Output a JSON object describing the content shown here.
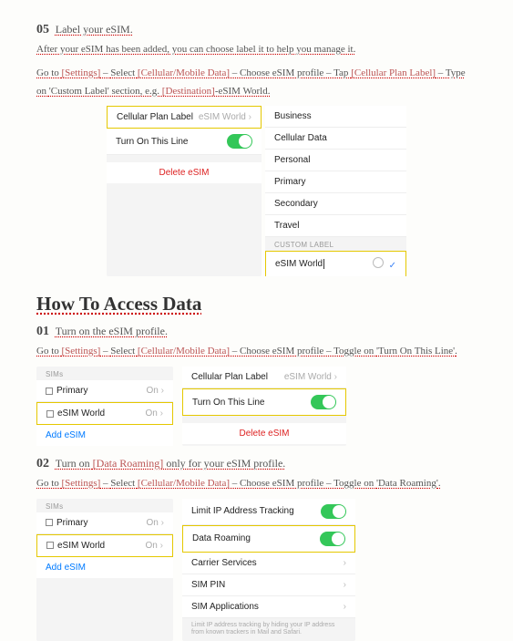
{
  "step05": {
    "num": "05",
    "title": "Label your eSIM.",
    "line1": "After your eSIM has been added, you can choose label it to help you manage it.",
    "line2a": "Go to ",
    "settings": "[Settings]",
    "sep": " – ",
    "select": "Select ",
    "cellular": "[Cellular/Mobile Data]",
    "choose": " – Choose eSIM profile – Tap ",
    "planlabel": "[Cellular Plan Label]",
    "typeon": " – Type on ",
    "customlabel": "'Custom Label'",
    "sectiontxt": " section, e.g. ",
    "dest": "[Destination]",
    "esimworld": "-eSIM World."
  },
  "mock05": {
    "cellularPlanLabel": "Cellular Plan Label",
    "esimWorldGrey": "eSIM World",
    "turnOn": "Turn On This Line",
    "delete": "Delete eSIM",
    "opts": [
      "Business",
      "Cellular Data",
      "Personal",
      "Primary",
      "Secondary",
      "Travel"
    ],
    "customLabelHdr": "CUSTOM LABEL",
    "inputVal": "eSIM World"
  },
  "sectionTitle": "How To Access Data",
  "step01": {
    "num": "01",
    "title": "Turn on the eSIM profile.",
    "instr_pre": "Go to ",
    "settings": "[Settings]",
    "sep": " – ",
    "select": "Select ",
    "cellular": "[Cellular/Mobile Data]",
    "choose": " – Choose eSIM profile – Toggle on ",
    "turnon": "'Turn On This Line'",
    "dot": "."
  },
  "mock01": {
    "simsHdr": "SIMs",
    "primary": "Primary",
    "on": "On",
    "esimWorld": "eSIM World",
    "addEsim": "Add eSIM",
    "cellularPlanLabel": "Cellular Plan Label",
    "esimWorldGrey": "eSIM World",
    "turnOn": "Turn On This Line",
    "delete": "Delete eSIM"
  },
  "step02": {
    "num": "02",
    "title_a": "Turn on ",
    "title_b": "[Data Roaming]",
    "title_c": " only for your eSIM profile.",
    "instr_pre": "Go to ",
    "settings": "[Settings]",
    "sep": " – ",
    "select": "Select ",
    "cellular": "[Cellular/Mobile Data]",
    "choose": " – Choose eSIM profile – Toggle on ",
    "roaming": "'Data Roaming'",
    "dot": "."
  },
  "mock02": {
    "simsHdr": "SIMs",
    "primary": "Primary",
    "on": "On",
    "esimWorld": "eSIM World",
    "addEsim": "Add eSIM",
    "limitIp": "Limit IP Address Tracking",
    "dataRoaming": "Data Roaming",
    "carrier": "Carrier Services",
    "simpin": "SIM PIN",
    "simapps": "SIM Applications",
    "footer": "Limit IP address tracking by hiding your IP address from known trackers in Mail and Safari."
  }
}
